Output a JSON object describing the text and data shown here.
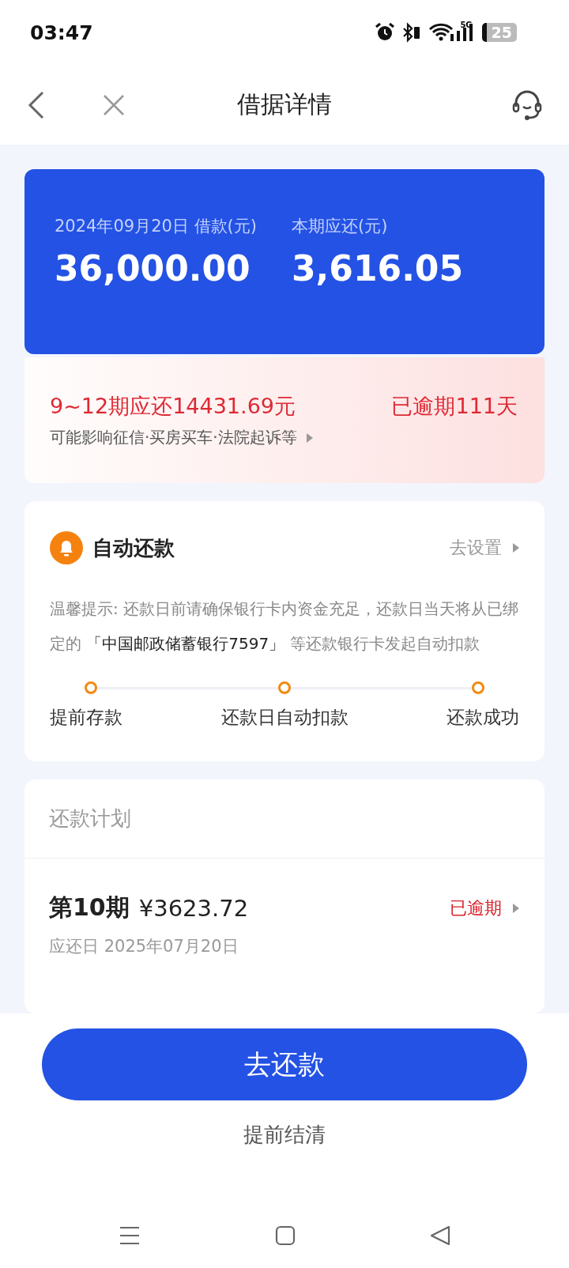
{
  "status_bar": {
    "time": "03:47",
    "network": "5G",
    "battery": "25"
  },
  "nav": {
    "title": "借据详情"
  },
  "loan": {
    "date_label": "2024年09月20日 借款(元)",
    "amount": "36,000.00",
    "due_label": "本期应还(元)",
    "due_amount": "3,616.05"
  },
  "overdue": {
    "summary": "9~12期应还14431.69元",
    "days": "已逾期111天",
    "warning": "可能影响征信·买房买车·法院起诉等"
  },
  "auto_repay": {
    "title": "自动还款",
    "link": "去设置",
    "hint_before": "温馨提示: 还款日前请确保银行卡内资金充足，还款日当天将从已绑定的 ",
    "hint_card": "「中国邮政储蓄银行7597」",
    "hint_after": " 等还款银行卡发起自动扣款",
    "steps": [
      {
        "label": "提前存款"
      },
      {
        "label": "还款日自动扣款"
      },
      {
        "label": "还款成功"
      }
    ]
  },
  "plan": {
    "title": "还款计划",
    "items": [
      {
        "period": "第10期",
        "amount": "¥3623.72",
        "status": "已逾期",
        "due": "应还日 2025年07月20日"
      }
    ]
  },
  "actions": {
    "primary": "去还款",
    "secondary": "提前结清"
  }
}
